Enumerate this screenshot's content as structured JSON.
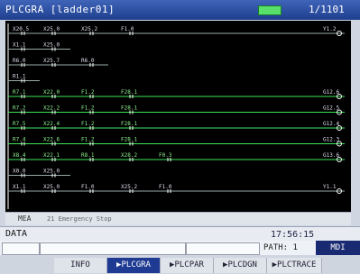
{
  "header": {
    "title": "PLCGRA [ladder01]",
    "page": "1/1101"
  },
  "ladder": {
    "rows": [
      {
        "contacts": [
          "X20.5",
          "X25.0",
          "X25.2",
          "F1.0"
        ],
        "coil": "Y1.2"
      },
      {
        "contacts": [
          "X1.1",
          "X25.0"
        ],
        "coil": ""
      },
      {
        "contacts": [
          "R6.0",
          "X25.7",
          "R6.0"
        ],
        "coil": ""
      },
      {
        "contacts": [
          "R1.1"
        ],
        "coil": ""
      },
      {
        "contacts": [
          "R7.1",
          "X22.0",
          "F1.2",
          "F28.1"
        ],
        "coil": "G12.6"
      },
      {
        "contacts": [
          "R7.2",
          "X22.2",
          "F1.2",
          "F28.1"
        ],
        "coil": "G12.5"
      },
      {
        "contacts": [
          "R7.5",
          "X22.4",
          "F1.2",
          "F28.1"
        ],
        "coil": "G12.4"
      },
      {
        "contacts": [
          "R7.4",
          "X22.6",
          "F1.2",
          "F28.1"
        ],
        "coil": "G12.3"
      },
      {
        "contacts": [
          "X8.4",
          "X22.1",
          "R8.1",
          "X28.2",
          "F0.3"
        ],
        "coil": "G13.6"
      },
      {
        "contacts": [
          "X0.0",
          "X25.0"
        ],
        "coil": ""
      },
      {
        "contacts": [
          "X1.1",
          "X25.0",
          "F1.0",
          "X25.2",
          "F1.0"
        ],
        "coil": "Y1.1"
      }
    ]
  },
  "message": {
    "type": "MEA",
    "text": "21 Emergency Stop"
  },
  "data": {
    "label": "DATA",
    "time": "17:56:15"
  },
  "status": {
    "path": "PATH: 1",
    "mode": "MDI"
  },
  "softkeys": [
    {
      "label": "INFO",
      "active": false
    },
    {
      "label": "PLCGRA",
      "active": true
    },
    {
      "label": "PLCPAR",
      "active": false
    },
    {
      "label": "PLCDGN",
      "active": false
    },
    {
      "label": "PLCTRACE",
      "active": false
    }
  ],
  "colors": {
    "title_bar": "#2a4fa8",
    "active_softkey": "#1e3a92",
    "rung_on": "#3fe65a",
    "rung_off": "#ffffff",
    "mode_bg": "#1a2a72"
  }
}
